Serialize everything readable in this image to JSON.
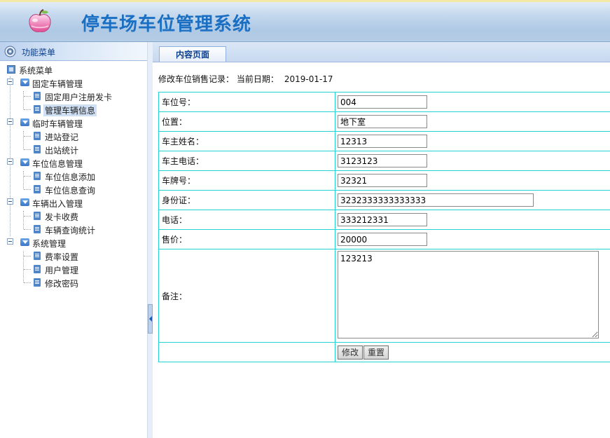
{
  "app": {
    "title": "停车场车位管理系统"
  },
  "sidebar": {
    "header_label": "功能菜单",
    "root_label": "系统菜单",
    "groups": [
      {
        "label": "固定车辆管理",
        "items": [
          {
            "label": "固定用户注册发卡"
          },
          {
            "label": "管理车辆信息",
            "selected": true
          }
        ]
      },
      {
        "label": "临时车辆管理",
        "items": [
          {
            "label": "进站登记"
          },
          {
            "label": "出站统计"
          }
        ]
      },
      {
        "label": "车位信息管理",
        "items": [
          {
            "label": "车位信息添加"
          },
          {
            "label": "车位信息查询"
          }
        ]
      },
      {
        "label": "车辆出入管理",
        "items": [
          {
            "label": "发卡收费"
          },
          {
            "label": "车辆查询统计"
          }
        ]
      },
      {
        "label": "系统管理",
        "items": [
          {
            "label": "费率设置"
          },
          {
            "label": "用户管理"
          },
          {
            "label": "修改密码"
          }
        ]
      }
    ]
  },
  "main": {
    "tab_label": "内容页面",
    "record_title": "修改车位销售记录：  当前日期：",
    "current_date": "2019-01-17",
    "form": {
      "fields": [
        {
          "label": "车位号：",
          "value": "004"
        },
        {
          "label": "位置：",
          "value": "地下室"
        },
        {
          "label": "车主姓名：",
          "value": "12313"
        },
        {
          "label": "车主电话：",
          "value": "3123123"
        },
        {
          "label": "车牌号：",
          "value": "32321"
        },
        {
          "label": "身份证：",
          "value": "3232333333333333"
        },
        {
          "label": "电话：",
          "value": "333212331"
        },
        {
          "label": "售价：",
          "value": "20000"
        }
      ],
      "remark_label": "备注：",
      "remark_value": "123213",
      "modify_button": "修改",
      "reset_button": "重置"
    }
  },
  "colors": {
    "title": "#1a6fc3",
    "table_border": "#26d3d3",
    "menu_text": "#0a3e8c"
  }
}
